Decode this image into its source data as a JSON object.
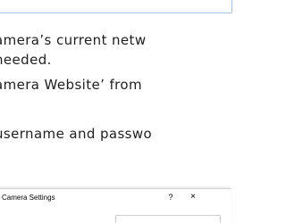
{
  "text": {
    "line1": "amera’s current netw",
    "line2": "needed.",
    "line3": "amera Website’ from",
    "line4": "username and passwo"
  },
  "dialog": {
    "title": "Camera Settings",
    "help": "?",
    "close": "×"
  }
}
